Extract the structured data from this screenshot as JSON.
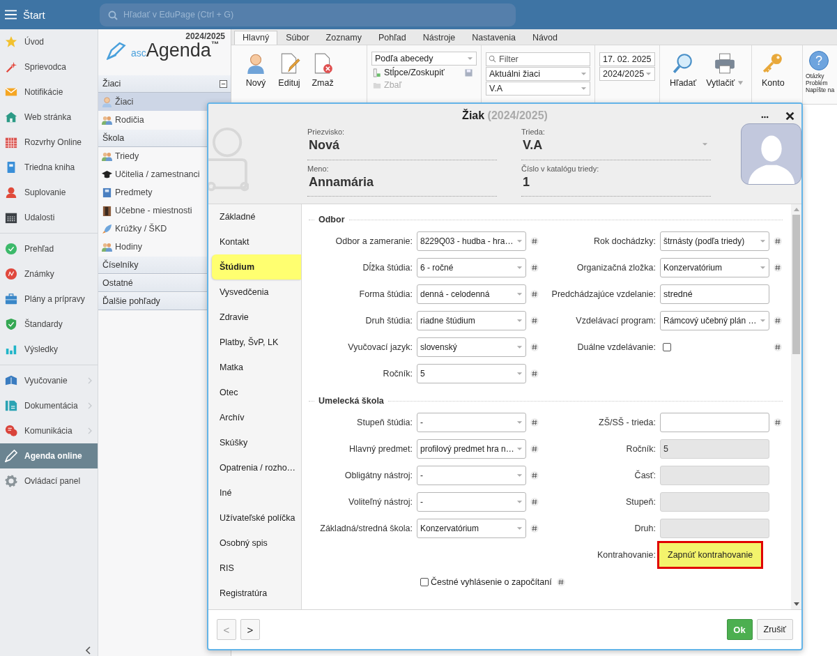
{
  "topbar": {
    "title": "Štart",
    "search_placeholder": "Hľadať v EduPage (Ctrl + G)"
  },
  "sidebar": {
    "groups": [
      {
        "items": [
          {
            "label": "Úvod",
            "selected": false,
            "has_submenu": false
          },
          {
            "label": "Sprievodca",
            "selected": false,
            "has_submenu": false
          },
          {
            "label": "Notifikácie",
            "selected": false,
            "has_submenu": false
          },
          {
            "label": "Web stránka",
            "selected": false,
            "has_submenu": false
          },
          {
            "label": "Rozvrhy Online",
            "selected": false,
            "has_submenu": false
          },
          {
            "label": "Triedna kniha",
            "selected": false,
            "has_submenu": false
          },
          {
            "label": "Suplovanie",
            "selected": false,
            "has_submenu": false
          },
          {
            "label": "Udalosti",
            "selected": false,
            "has_submenu": false
          }
        ]
      },
      {
        "items": [
          {
            "label": "Prehľad",
            "selected": false,
            "has_submenu": false
          },
          {
            "label": "Známky",
            "selected": false,
            "has_submenu": false
          },
          {
            "label": "Plány a prípravy",
            "selected": false,
            "has_submenu": false
          },
          {
            "label": "Štandardy",
            "selected": false,
            "has_submenu": false
          },
          {
            "label": "Výsledky",
            "selected": false,
            "has_submenu": false
          }
        ]
      },
      {
        "items": [
          {
            "label": "Vyučovanie",
            "selected": false,
            "has_submenu": true
          },
          {
            "label": "Dokumentácia",
            "selected": false,
            "has_submenu": true
          },
          {
            "label": "Komunikácia",
            "selected": false,
            "has_submenu": true
          },
          {
            "label": "Agenda online",
            "selected": true,
            "has_submenu": false
          },
          {
            "label": "Ovládací panel",
            "selected": false,
            "has_submenu": false
          }
        ]
      }
    ]
  },
  "panel": {
    "year": "2024/2025",
    "logo": {
      "prefix": "asc",
      "name": "Agenda",
      "mark": "™"
    },
    "sections": [
      {
        "title": "Žiaci",
        "collapse_button": true,
        "items": [
          {
            "label": "Žiaci",
            "selected": true
          },
          {
            "label": "Rodičia",
            "selected": false
          }
        ]
      },
      {
        "title": "Škola",
        "collapse_button": false,
        "items": [
          {
            "label": "Triedy",
            "selected": false
          },
          {
            "label": "Učitelia / zamestnanci",
            "selected": false
          },
          {
            "label": "Predmety",
            "selected": false
          },
          {
            "label": "Učebne - miestnosti",
            "selected": false
          },
          {
            "label": "Krúžky / ŠKD",
            "selected": false
          },
          {
            "label": "Hodiny",
            "selected": false
          }
        ]
      },
      {
        "title": "Číselníky",
        "collapse_button": false
      },
      {
        "title": "Ostatné",
        "collapse_button": false
      },
      {
        "title": "Ďalšie pohľady",
        "collapse_button": false
      }
    ]
  },
  "tabs": [
    {
      "label": "Hlavný",
      "selected": true
    },
    {
      "label": "Súbor",
      "selected": false
    },
    {
      "label": "Zoznamy",
      "selected": false
    },
    {
      "label": "Pohľad",
      "selected": false
    },
    {
      "label": "Nástroje",
      "selected": false
    },
    {
      "label": "Nastavenia",
      "selected": false
    },
    {
      "label": "Návod",
      "selected": false
    }
  ],
  "ribbon": {
    "new": "Nový",
    "edit": "Edituj",
    "delete": "Zmaž",
    "sort": "Podľa abecedy",
    "columns": "Stĺpce/Zoskupiť",
    "collapse": {
      "label": "Zbaľ",
      "disabled": true
    },
    "filter_placeholder": "Filter",
    "student_filter": "Aktuálni žiaci",
    "class_filter": "V.A",
    "date": "17. 02. 2025",
    "year": "2024/2025",
    "search": "Hľadať",
    "print": "Vytlačiť",
    "account": "Konto",
    "help_icon": "?",
    "help_lines": [
      "Otázky",
      "Problém",
      "Napíšte na"
    ]
  },
  "dialog": {
    "title": "Žiak",
    "subtitle": "(2024/2025)",
    "header_fields": [
      {
        "label": "Priezvisko:",
        "value": "Nová",
        "dropdown": false
      },
      {
        "label": "Trieda:",
        "value": "V.A",
        "dropdown": true
      },
      {
        "label": "Meno:",
        "value": "Annamária",
        "dropdown": false
      },
      {
        "label": "Číslo v katalógu triedy:",
        "value": "1",
        "dropdown": false
      }
    ],
    "nav": [
      {
        "label": "Základné",
        "selected": false
      },
      {
        "label": "Kontakt",
        "selected": false
      },
      {
        "label": "Štúdium",
        "selected": true
      },
      {
        "label": "Vysvedčenia",
        "selected": false
      },
      {
        "label": "Zdravie",
        "selected": false
      },
      {
        "label": "Platby, ŠvP, LK",
        "selected": false
      },
      {
        "label": "Matka",
        "selected": false
      },
      {
        "label": "Otec",
        "selected": false
      },
      {
        "label": "Archív",
        "selected": false
      },
      {
        "label": "Skúšky",
        "selected": false
      },
      {
        "label": "Opatrenia / rozho…",
        "selected": false
      },
      {
        "label": "Iné",
        "selected": false
      },
      {
        "label": "Užívateľské políčka",
        "selected": false
      },
      {
        "label": "Osobný spis",
        "selected": false
      },
      {
        "label": "RIS",
        "selected": false
      },
      {
        "label": "Registratúra",
        "selected": false
      }
    ],
    "sections": [
      {
        "title": "Odbor",
        "left": [
          {
            "kind": "select",
            "label": "Odbor a zameranie:",
            "value": "8229Q03 - hudba - hra…",
            "disabled": false,
            "has_history": true
          },
          {
            "kind": "select",
            "label": "Dĺžka štúdia:",
            "value": "6 - ročné",
            "disabled": false,
            "has_history": true
          },
          {
            "kind": "select",
            "label": "Forma štúdia:",
            "value": "denná - celodenná",
            "disabled": false,
            "has_history": true
          },
          {
            "kind": "select",
            "label": "Druh štúdia:",
            "value": "riadne štúdium",
            "disabled": false,
            "has_history": true
          },
          {
            "kind": "select",
            "label": "Vyučovací jazyk:",
            "value": "slovenský",
            "disabled": false,
            "has_history": true
          },
          {
            "kind": "select",
            "label": "Ročník:",
            "value": "5",
            "disabled": false,
            "has_history": true
          }
        ],
        "right": [
          {
            "kind": "select",
            "label": "Rok dochádzky:",
            "value": "štrnásty (podľa triedy)",
            "disabled": false,
            "has_history": true
          },
          {
            "kind": "select",
            "label": "Organizačná zložka:",
            "value": "Konzervatórium",
            "disabled": false,
            "has_history": true
          },
          {
            "kind": "text",
            "label": "Predchádzajúce vzdelanie:",
            "value": "stredné",
            "disabled": false,
            "has_history": false
          },
          {
            "kind": "select",
            "label": "Vzdelávací program:",
            "value": "Rámcový učebný plán …",
            "disabled": false,
            "has_history": true
          },
          {
            "kind": "checkbox",
            "label": "Duálne vzdelávanie:",
            "checked": false,
            "disabled": false,
            "has_history": true
          }
        ]
      },
      {
        "title": "Umelecká škola",
        "left": [
          {
            "kind": "select",
            "label": "Stupeň štúdia:",
            "value": "-",
            "disabled": false,
            "has_history": true
          },
          {
            "kind": "select",
            "label": "Hlavný predmet:",
            "value": "profilový predmet hra n…",
            "disabled": false,
            "has_history": true
          },
          {
            "kind": "select",
            "label": "Obligátny nástroj:",
            "value": "-",
            "disabled": false,
            "has_history": true
          },
          {
            "kind": "select",
            "label": "Voliteľný nástroj:",
            "value": "-",
            "disabled": false,
            "has_history": true
          },
          {
            "kind": "select",
            "label": "Základná/stredná škola:",
            "value": "Konzervatórium",
            "disabled": false,
            "has_history": true
          }
        ],
        "right": [
          {
            "kind": "text",
            "label": "ZŠ/SŠ - trieda:",
            "disabled": false,
            "has_history": true
          },
          {
            "kind": "text",
            "label": "Ročník:",
            "value": "5",
            "disabled": true,
            "has_history": false
          },
          {
            "kind": "text",
            "label": "Časť:",
            "disabled": true,
            "has_history": false
          },
          {
            "kind": "text",
            "label": "Stupeň:",
            "disabled": true,
            "has_history": false
          },
          {
            "kind": "text",
            "label": "Druh:",
            "disabled": true,
            "has_history": false
          },
          {
            "kind": "button",
            "label": "Kontrahovanie:",
            "button_label": "Zapnúť kontrahovanie",
            "highlighted": true,
            "disabled": false,
            "has_history": false
          }
        ]
      }
    ],
    "declaration": {
      "label": "Čestné vyhlásenie o započítaní",
      "checked": false,
      "has_history": true
    },
    "footer": {
      "prev": {
        "label": "<",
        "disabled": true
      },
      "next": {
        "label": ">",
        "disabled": false
      },
      "ok": "Ok",
      "cancel": "Zrušiť"
    }
  }
}
